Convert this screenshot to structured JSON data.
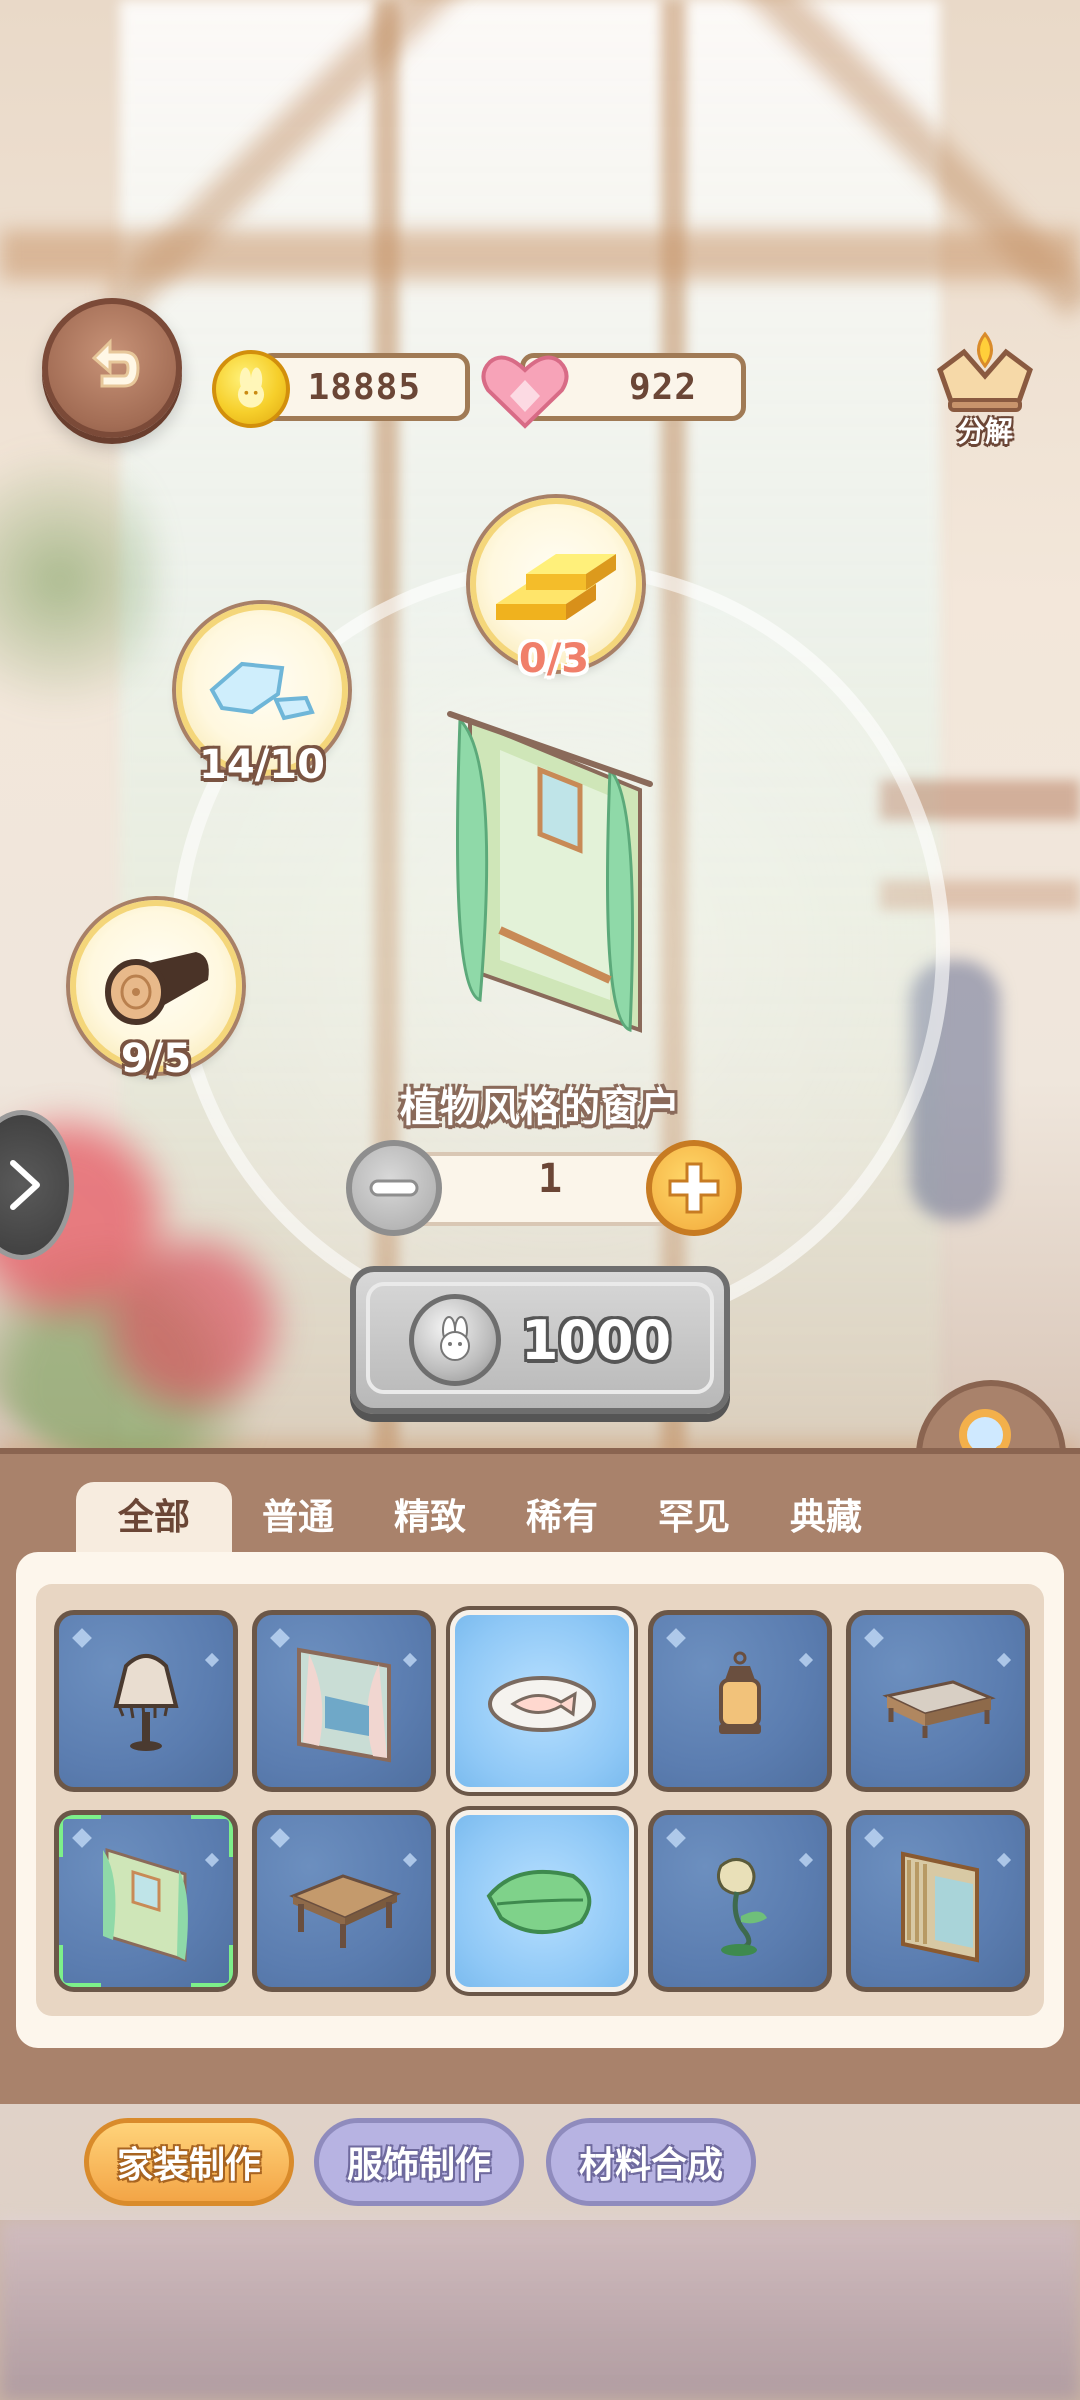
{
  "currency": {
    "coins": "18885",
    "hearts": "922"
  },
  "decompose_label": "分解",
  "materials": [
    {
      "name": "gold-bar",
      "count": "0/3",
      "sufficient": false
    },
    {
      "name": "ice-crystal",
      "count": "14/10",
      "sufficient": true
    },
    {
      "name": "wood-log",
      "count": "9/5",
      "sufficient": true
    }
  ],
  "item": {
    "name": "植物风格的窗户",
    "quantity": "1",
    "cost": "1000"
  },
  "tabs": [
    "全部",
    "普通",
    "精致",
    "稀有",
    "罕见",
    "典藏"
  ],
  "active_tab": "全部",
  "grid_items": [
    {
      "icon": "lamp-icon",
      "highlight": false
    },
    {
      "icon": "curtain-window-icon",
      "highlight": false
    },
    {
      "icon": "fish-plate-icon",
      "highlight": true
    },
    {
      "icon": "lantern-icon",
      "highlight": false
    },
    {
      "icon": "bed-icon",
      "highlight": false
    },
    {
      "icon": "plant-window-icon",
      "highlight": false,
      "selected": true
    },
    {
      "icon": "wooden-table-icon",
      "highlight": false
    },
    {
      "icon": "leaf-mat-icon",
      "highlight": true
    },
    {
      "icon": "flower-lamp-icon",
      "highlight": false
    },
    {
      "icon": "bamboo-curtain-icon",
      "highlight": false
    }
  ],
  "categories": [
    "家装制作",
    "服饰制作",
    "材料合成"
  ],
  "active_category": "家装制作",
  "colors": {
    "panel": "#a9826b",
    "accent": "#f3a546",
    "insufficient": "#f07f6a"
  }
}
